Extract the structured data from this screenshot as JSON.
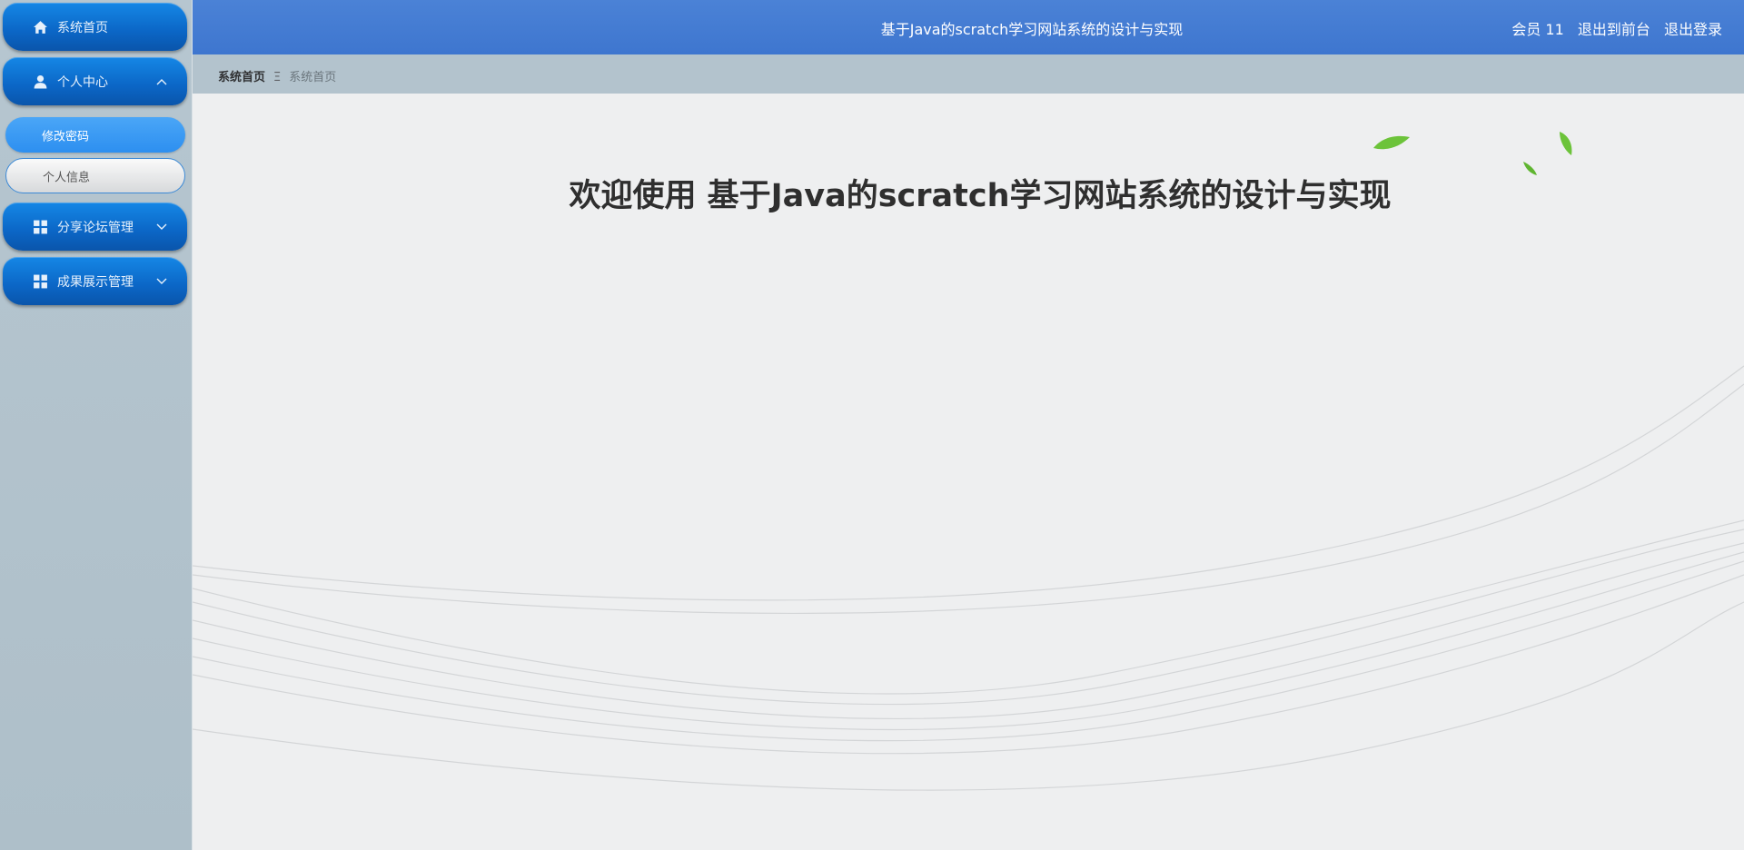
{
  "sidebar": {
    "items": [
      {
        "label": "系统首页",
        "icon": "home-icon",
        "expanded": false
      },
      {
        "label": "个人中心",
        "icon": "user-icon",
        "expanded": true,
        "children": [
          {
            "label": "修改密码",
            "active": true
          },
          {
            "label": "个人信息",
            "active": false
          }
        ]
      },
      {
        "label": "分享论坛管理",
        "icon": "grid-icon",
        "expanded": false
      },
      {
        "label": "成果展示管理",
        "icon": "grid-icon",
        "expanded": false
      }
    ]
  },
  "header": {
    "title": "基于Java的scratch学习网站系统的设计与实现",
    "user": "会员 11",
    "back_to_front": "退出到前台",
    "logout": "退出登录"
  },
  "breadcrumb": {
    "root": "系统首页",
    "separator": "Ξ",
    "current": "系统首页"
  },
  "main": {
    "welcome": "欢迎使用 基于Java的scratch学习网站系统的设计与实现"
  },
  "colors": {
    "header_bg": "#4179d3",
    "nav_item_bg": "#0b6ccc",
    "nav_sub_active_bg": "#3b9af3",
    "content_bg": "#eeeff0"
  }
}
